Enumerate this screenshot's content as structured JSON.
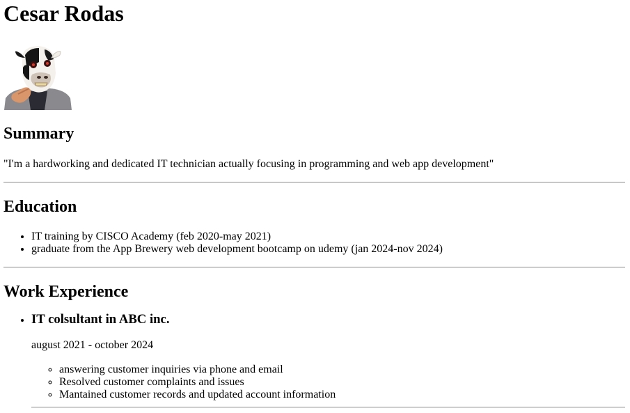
{
  "header": {
    "name": "Cesar Rodas"
  },
  "avatar": {
    "alt": "Cesar Rodas avatar"
  },
  "summary": {
    "heading": "Summary",
    "text": "\"I'm a hardworking and dedicated IT technician actually focusing in programming and web app development\""
  },
  "education": {
    "heading": "Education",
    "items": [
      "IT training by CISCO Academy (feb 2020-may 2021)",
      "graduate from the App Brewery web development bootcamp on udemy (jan 2024-nov 2024)"
    ]
  },
  "work": {
    "heading": "Work Experience",
    "jobs": [
      {
        "title": "IT colsultant in ABC inc.",
        "dates": "august 2021 - october 2024",
        "duties": [
          "answering customer inquiries via phone and email",
          "Resolved customer complaints and issues",
          "Mantained customer records and updated account information"
        ]
      }
    ]
  }
}
